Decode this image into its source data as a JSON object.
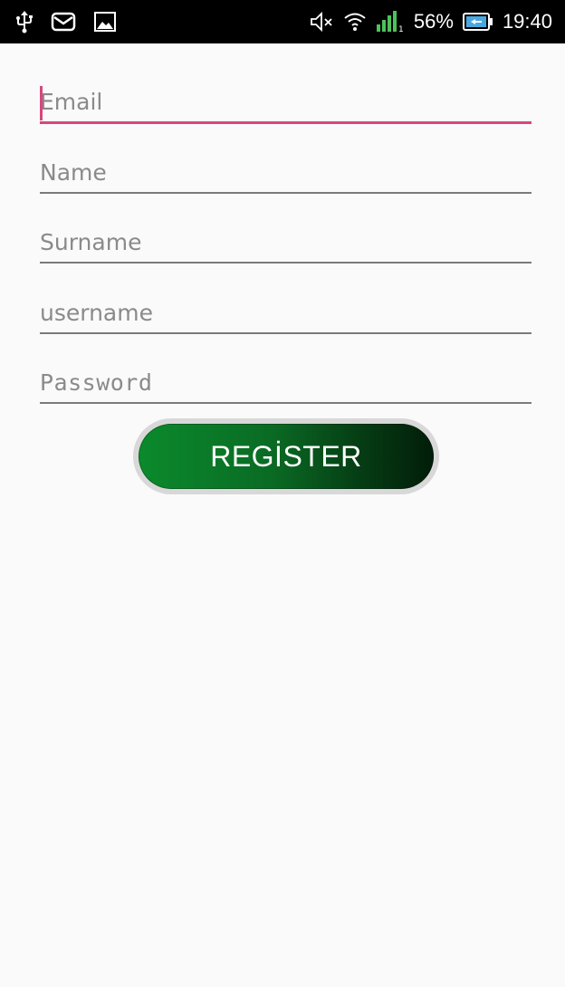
{
  "status_bar": {
    "icons_left": [
      "usb-icon",
      "message-icon",
      "image-icon"
    ],
    "icons_right": [
      "mute-icon",
      "wifi-icon",
      "signal-icon",
      "battery-icon"
    ],
    "battery": "56%",
    "time": "19:40"
  },
  "form": {
    "email_placeholder": "Email",
    "name_placeholder": "Name",
    "surname_placeholder": "Surname",
    "username_placeholder": "username",
    "password_placeholder": "Password",
    "register_label": "REGİSTER"
  },
  "colors": {
    "accent": "#d6477e",
    "button_start": "#0b8a2c",
    "button_end": "#021d08",
    "background": "#fafafa"
  }
}
